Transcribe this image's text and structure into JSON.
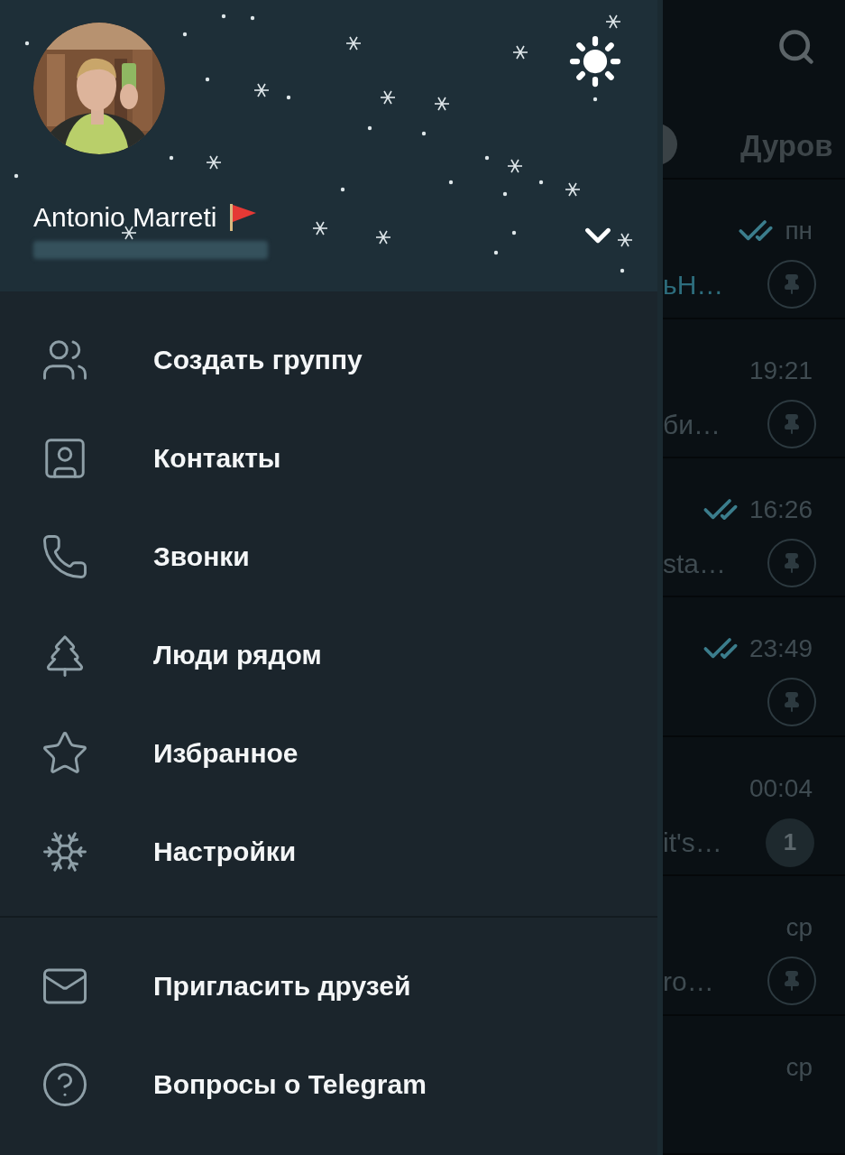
{
  "profile": {
    "name": "Antonio Marreti"
  },
  "menu_sections": [
    [
      {
        "kind": "group",
        "label": "Создать группу"
      },
      {
        "kind": "contacts",
        "label": "Контакты"
      },
      {
        "kind": "calls",
        "label": "Звонки"
      },
      {
        "kind": "nearby",
        "label": "Люди рядом"
      },
      {
        "kind": "saved",
        "label": "Избранное"
      },
      {
        "kind": "settings",
        "label": "Настройки"
      }
    ],
    [
      {
        "kind": "invite",
        "label": "Пригласить друзей"
      },
      {
        "kind": "faq",
        "label": "Вопросы о Telegram"
      }
    ]
  ],
  "background": {
    "tab": "Дуров",
    "chats": [
      {
        "time": "пн",
        "read": true,
        "snippet": "ьН…",
        "highlighted": true,
        "pinned": true
      },
      {
        "time": "19:21",
        "read": false,
        "snippet": "би…",
        "highlighted": false,
        "pinned": true
      },
      {
        "time": "16:26",
        "read": true,
        "snippet": "sta…",
        "highlighted": false,
        "pinned": true
      },
      {
        "time": "23:49",
        "read": true,
        "pinned": true
      },
      {
        "time": "00:04",
        "read": false,
        "snippet": "it's…",
        "highlighted": false,
        "pinned": false,
        "unread": "1"
      },
      {
        "time": "ср",
        "read": false,
        "snippet": "ro…",
        "highlighted": false,
        "pinned": true
      },
      {
        "time": "ср",
        "read": false,
        "pinned": false
      }
    ]
  }
}
